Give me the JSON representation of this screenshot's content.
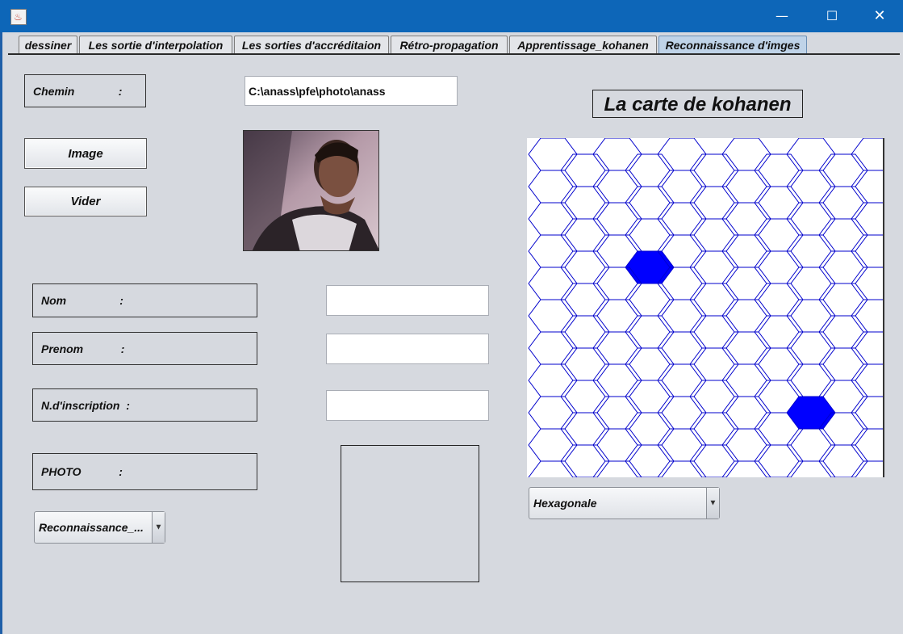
{
  "window": {
    "minimize_glyph": "—",
    "maximize_glyph": "☐",
    "close_glyph": "✕",
    "app_icon": "java-cup-icon"
  },
  "tabs": [
    {
      "label": "dessiner"
    },
    {
      "label": "Les sortie d'interpolation"
    },
    {
      "label": "Les sorties d'accréditaion"
    },
    {
      "label": "Rétro-propagation"
    },
    {
      "label": "Apprentissage_kohanen"
    },
    {
      "label": "Reconnaissance d'imges"
    }
  ],
  "active_tab": 5,
  "form": {
    "chemin_label": "Chemin              :",
    "chemin_value": "C:\\anass\\pfe\\photo\\anass",
    "image_button": "Image",
    "vider_button": "Vider",
    "nom_label": "Nom                 :",
    "nom_value": "",
    "prenom_label": "Prenom            :",
    "prenom_value": "",
    "inscription_label": "N.d'inscription  :",
    "inscription_value": "",
    "photo_label": "PHOTO            :",
    "mode_select": "Reconnaissance_..."
  },
  "map": {
    "title": "La carte de kohanen",
    "shape_select": "Hexagonale",
    "line_color": "#0000cc",
    "fill_color": "#0000ff",
    "highlighted_cells": [
      {
        "col": 3,
        "row": 3
      },
      {
        "col": 8,
        "row": 8
      }
    ]
  },
  "colors": {
    "titlebar": "#0d66b8",
    "background": "#d6d9df"
  }
}
